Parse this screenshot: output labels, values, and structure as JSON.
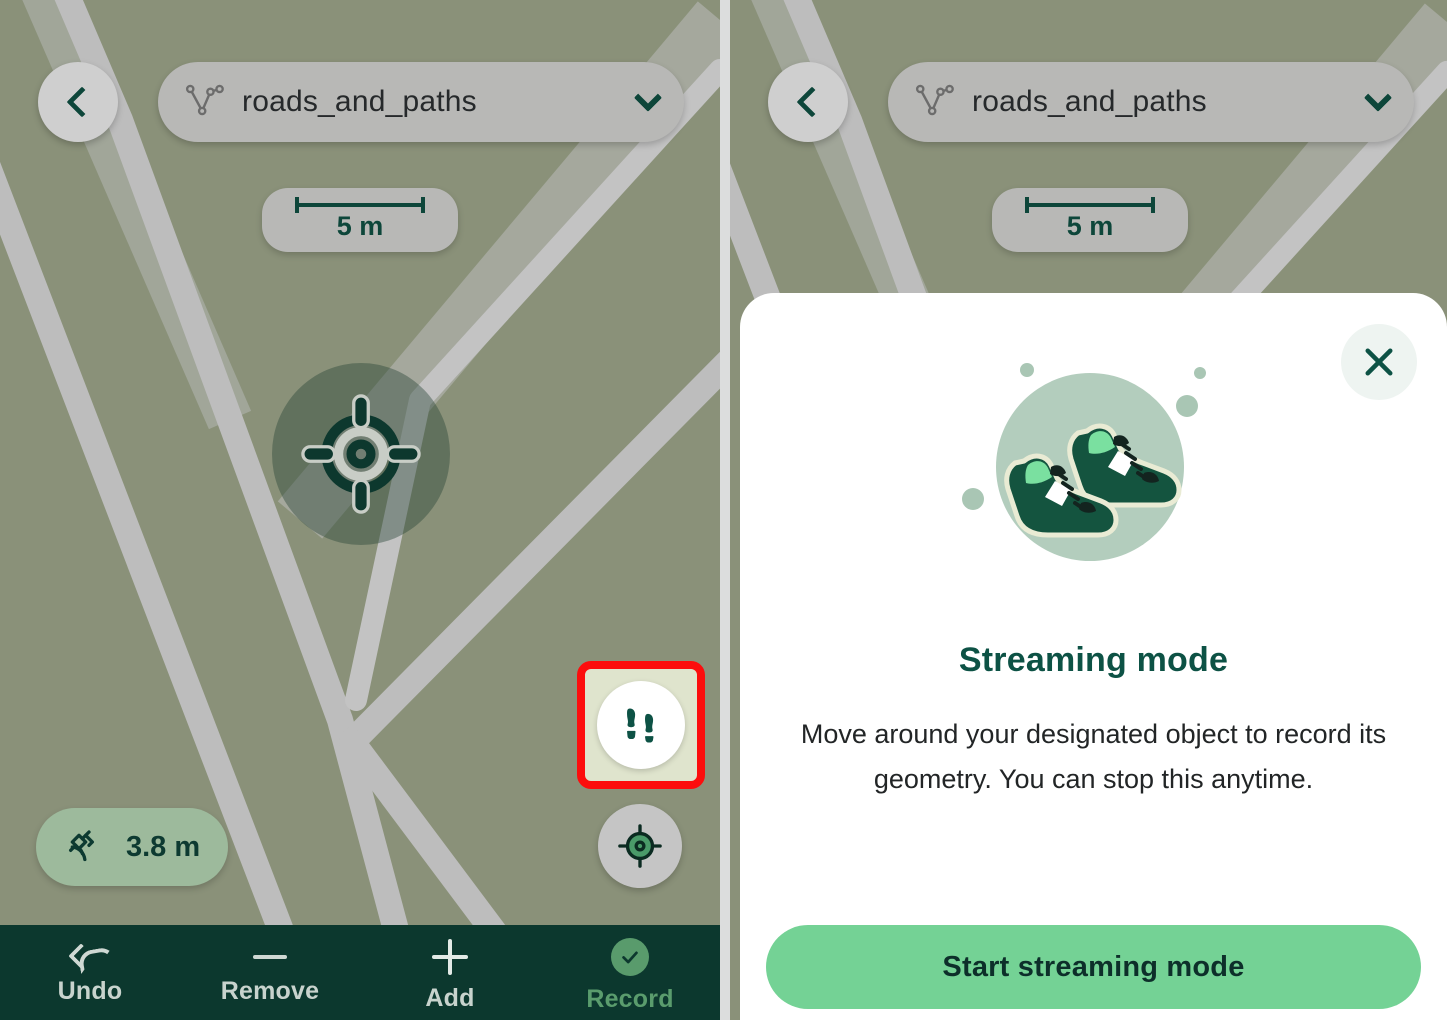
{
  "app": {
    "left_panel_name": "map-editor-screen",
    "right_panel_name": "streaming-mode-dialog-screen"
  },
  "topbar": {
    "back_icon": "chevron-left-icon",
    "layer": {
      "geometry_icon": "polyline-icon",
      "label": "roads_and_paths",
      "dropdown_icon": "chevron-down-icon"
    }
  },
  "scale": {
    "label": "5 m"
  },
  "map": {
    "center_marker_icon": "crosshair-target-icon",
    "gps": {
      "icon": "satellite-icon",
      "accuracy": "3.8 m"
    },
    "locate_icon": "locate-target-icon",
    "streaming_toggle_icon": "footprints-icon"
  },
  "toolbar": {
    "items": [
      {
        "label": "Undo",
        "icon": "undo-arrow-icon"
      },
      {
        "label": "Remove",
        "icon": "minus-icon"
      },
      {
        "label": "Add",
        "icon": "plus-icon"
      },
      {
        "label": "Record",
        "icon": "check-circle-icon"
      }
    ]
  },
  "dialog": {
    "close_icon": "close-x-icon",
    "hero_icon": "sneakers-icon",
    "title": "Streaming mode",
    "body": "Move around your designated object to record its geometry. You can stop this anytime.",
    "primary_button": "Start streaming mode"
  },
  "colors": {
    "map_background": "#8a9179",
    "road": "#bdbdbd",
    "toolbar_background": "#0c382e",
    "brand_green": "#0d5245",
    "accent_green": "#74d295",
    "gps_pill": "#9dba9c",
    "highlight_red": "#fc0d0d",
    "hero_circle": "#b3cdbd"
  }
}
